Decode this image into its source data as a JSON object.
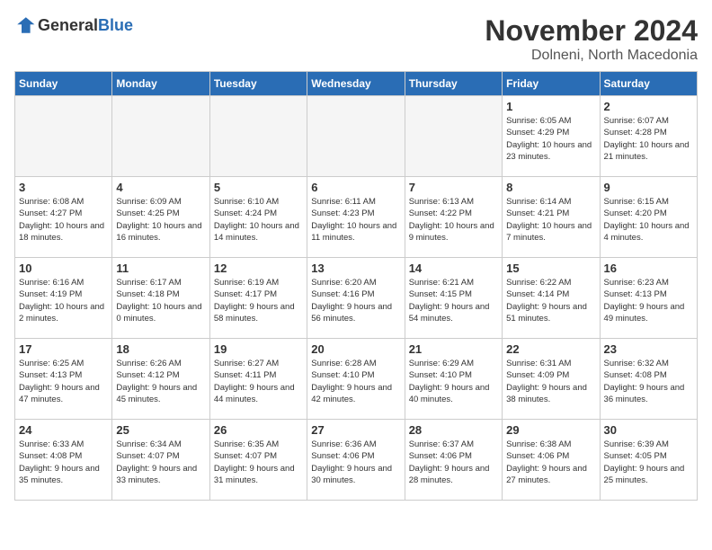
{
  "logo": {
    "general": "General",
    "blue": "Blue"
  },
  "title": "November 2024",
  "location": "Dolneni, North Macedonia",
  "headers": [
    "Sunday",
    "Monday",
    "Tuesday",
    "Wednesday",
    "Thursday",
    "Friday",
    "Saturday"
  ],
  "weeks": [
    [
      {
        "day": "",
        "info": ""
      },
      {
        "day": "",
        "info": ""
      },
      {
        "day": "",
        "info": ""
      },
      {
        "day": "",
        "info": ""
      },
      {
        "day": "",
        "info": ""
      },
      {
        "day": "1",
        "info": "Sunrise: 6:05 AM\nSunset: 4:29 PM\nDaylight: 10 hours and 23 minutes."
      },
      {
        "day": "2",
        "info": "Sunrise: 6:07 AM\nSunset: 4:28 PM\nDaylight: 10 hours and 21 minutes."
      }
    ],
    [
      {
        "day": "3",
        "info": "Sunrise: 6:08 AM\nSunset: 4:27 PM\nDaylight: 10 hours and 18 minutes."
      },
      {
        "day": "4",
        "info": "Sunrise: 6:09 AM\nSunset: 4:25 PM\nDaylight: 10 hours and 16 minutes."
      },
      {
        "day": "5",
        "info": "Sunrise: 6:10 AM\nSunset: 4:24 PM\nDaylight: 10 hours and 14 minutes."
      },
      {
        "day": "6",
        "info": "Sunrise: 6:11 AM\nSunset: 4:23 PM\nDaylight: 10 hours and 11 minutes."
      },
      {
        "day": "7",
        "info": "Sunrise: 6:13 AM\nSunset: 4:22 PM\nDaylight: 10 hours and 9 minutes."
      },
      {
        "day": "8",
        "info": "Sunrise: 6:14 AM\nSunset: 4:21 PM\nDaylight: 10 hours and 7 minutes."
      },
      {
        "day": "9",
        "info": "Sunrise: 6:15 AM\nSunset: 4:20 PM\nDaylight: 10 hours and 4 minutes."
      }
    ],
    [
      {
        "day": "10",
        "info": "Sunrise: 6:16 AM\nSunset: 4:19 PM\nDaylight: 10 hours and 2 minutes."
      },
      {
        "day": "11",
        "info": "Sunrise: 6:17 AM\nSunset: 4:18 PM\nDaylight: 10 hours and 0 minutes."
      },
      {
        "day": "12",
        "info": "Sunrise: 6:19 AM\nSunset: 4:17 PM\nDaylight: 9 hours and 58 minutes."
      },
      {
        "day": "13",
        "info": "Sunrise: 6:20 AM\nSunset: 4:16 PM\nDaylight: 9 hours and 56 minutes."
      },
      {
        "day": "14",
        "info": "Sunrise: 6:21 AM\nSunset: 4:15 PM\nDaylight: 9 hours and 54 minutes."
      },
      {
        "day": "15",
        "info": "Sunrise: 6:22 AM\nSunset: 4:14 PM\nDaylight: 9 hours and 51 minutes."
      },
      {
        "day": "16",
        "info": "Sunrise: 6:23 AM\nSunset: 4:13 PM\nDaylight: 9 hours and 49 minutes."
      }
    ],
    [
      {
        "day": "17",
        "info": "Sunrise: 6:25 AM\nSunset: 4:13 PM\nDaylight: 9 hours and 47 minutes."
      },
      {
        "day": "18",
        "info": "Sunrise: 6:26 AM\nSunset: 4:12 PM\nDaylight: 9 hours and 45 minutes."
      },
      {
        "day": "19",
        "info": "Sunrise: 6:27 AM\nSunset: 4:11 PM\nDaylight: 9 hours and 44 minutes."
      },
      {
        "day": "20",
        "info": "Sunrise: 6:28 AM\nSunset: 4:10 PM\nDaylight: 9 hours and 42 minutes."
      },
      {
        "day": "21",
        "info": "Sunrise: 6:29 AM\nSunset: 4:10 PM\nDaylight: 9 hours and 40 minutes."
      },
      {
        "day": "22",
        "info": "Sunrise: 6:31 AM\nSunset: 4:09 PM\nDaylight: 9 hours and 38 minutes."
      },
      {
        "day": "23",
        "info": "Sunrise: 6:32 AM\nSunset: 4:08 PM\nDaylight: 9 hours and 36 minutes."
      }
    ],
    [
      {
        "day": "24",
        "info": "Sunrise: 6:33 AM\nSunset: 4:08 PM\nDaylight: 9 hours and 35 minutes."
      },
      {
        "day": "25",
        "info": "Sunrise: 6:34 AM\nSunset: 4:07 PM\nDaylight: 9 hours and 33 minutes."
      },
      {
        "day": "26",
        "info": "Sunrise: 6:35 AM\nSunset: 4:07 PM\nDaylight: 9 hours and 31 minutes."
      },
      {
        "day": "27",
        "info": "Sunrise: 6:36 AM\nSunset: 4:06 PM\nDaylight: 9 hours and 30 minutes."
      },
      {
        "day": "28",
        "info": "Sunrise: 6:37 AM\nSunset: 4:06 PM\nDaylight: 9 hours and 28 minutes."
      },
      {
        "day": "29",
        "info": "Sunrise: 6:38 AM\nSunset: 4:06 PM\nDaylight: 9 hours and 27 minutes."
      },
      {
        "day": "30",
        "info": "Sunrise: 6:39 AM\nSunset: 4:05 PM\nDaylight: 9 hours and 25 minutes."
      }
    ]
  ]
}
